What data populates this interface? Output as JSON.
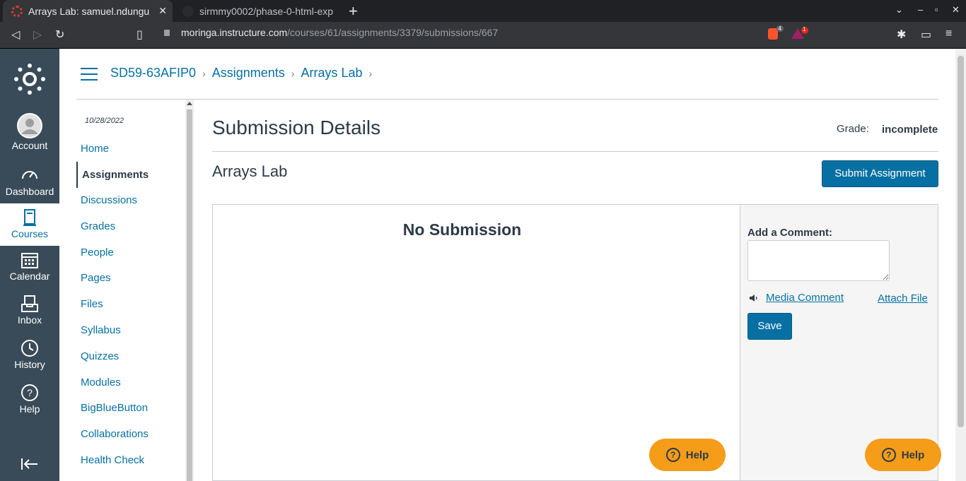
{
  "browser": {
    "tabs": [
      {
        "title": "Arrays Lab: samuel.ndungu",
        "active": true
      },
      {
        "title": "sirmmy0002/phase-0-html-exp",
        "active": false
      }
    ],
    "new_tab_icon": "+",
    "url_host": "moringa.instructure.com",
    "url_path": "/courses/61/assignments/3379/submissions/667",
    "ext_badges": [
      "4",
      "1"
    ]
  },
  "global_nav": {
    "items": [
      {
        "label": "Account",
        "icon": "avatar-icon"
      },
      {
        "label": "Dashboard",
        "icon": "dashboard-icon"
      },
      {
        "label": "Courses",
        "icon": "courses-icon",
        "active": true
      },
      {
        "label": "Calendar",
        "icon": "calendar-icon"
      },
      {
        "label": "Inbox",
        "icon": "inbox-icon"
      },
      {
        "label": "History",
        "icon": "history-icon"
      },
      {
        "label": "Help",
        "icon": "help-icon"
      }
    ]
  },
  "breadcrumb": [
    "SD59-63AFIP0",
    "Assignments",
    "Arrays Lab"
  ],
  "course_nav": {
    "date": "10/28/2022",
    "items": [
      "Home",
      "Assignments",
      "Discussions",
      "Grades",
      "People",
      "Pages",
      "Files",
      "Syllabus",
      "Quizzes",
      "Modules",
      "BigBlueButton",
      "Collaborations",
      "Health Check"
    ],
    "active_index": 1
  },
  "main": {
    "title": "Submission Details",
    "grade_label": "Grade:",
    "grade_value": "incomplete",
    "assignment_name": "Arrays Lab",
    "submit_button": "Submit Assignment",
    "no_submission": "No Submission"
  },
  "comments": {
    "label": "Add a Comment:",
    "media_comment": "Media Comment",
    "attach_file": "Attach File",
    "save_button": "Save"
  },
  "help_label": "Help",
  "colors": {
    "link": "#0770a3",
    "nav_bg": "#394b58",
    "help": "#f59c19"
  }
}
